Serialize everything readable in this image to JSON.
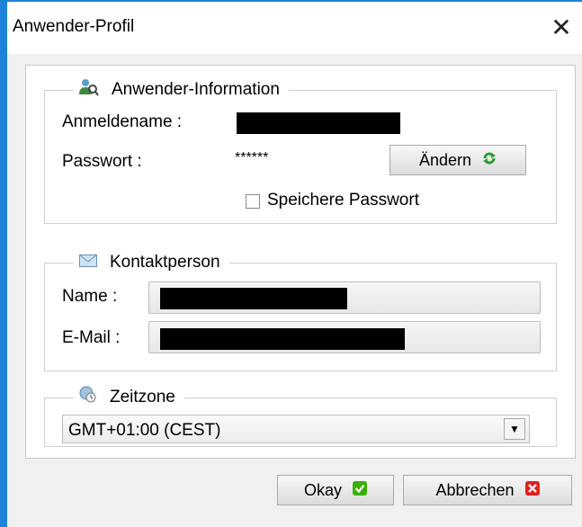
{
  "window": {
    "title": "Anwender-Profil",
    "close_glyph": "✕"
  },
  "user_info": {
    "legend": "Anwender-Information",
    "icon": "user-search-icon",
    "login_label": "Anmeldename :",
    "login_value": "",
    "password_label": "Passwort :",
    "password_value": "******",
    "change_button": "Ändern",
    "save_password_label": "Speichere Passwort",
    "save_password_checked": false
  },
  "contact": {
    "legend": "Kontaktperson",
    "icon": "envelope-icon",
    "name_label": "Name :",
    "name_value": "",
    "email_label": "E-Mail :",
    "email_value": ""
  },
  "timezone": {
    "legend": "Zeitzone",
    "icon": "globe-clock-icon",
    "selected": "GMT+01:00 (CEST)",
    "dropdown_arrow": "▼"
  },
  "footer": {
    "ok_label": "Okay",
    "cancel_label": "Abbrechen"
  },
  "colors": {
    "accent": "#1e82d8",
    "ok_green": "#38b000",
    "cancel_red": "#e02020",
    "refresh_green": "#2a9d2a"
  }
}
